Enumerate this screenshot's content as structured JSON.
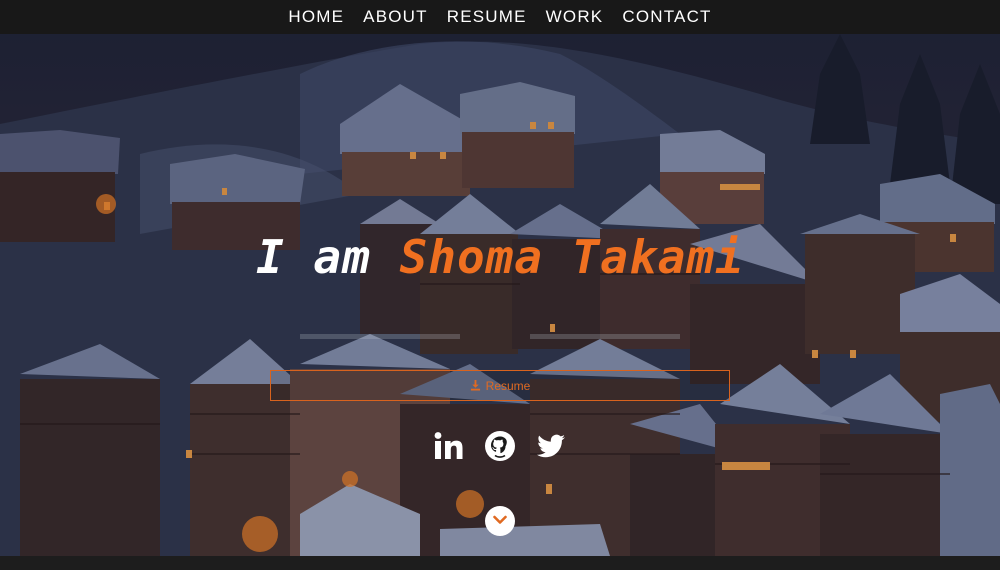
{
  "nav": {
    "items": [
      {
        "label": "HOME"
      },
      {
        "label": "ABOUT"
      },
      {
        "label": "RESUME"
      },
      {
        "label": "WORK"
      },
      {
        "label": "CONTACT"
      }
    ]
  },
  "hero": {
    "headline_prefix": "I am ",
    "headline_name": "Shoma Takami",
    "resume_button_label": "Resume",
    "resume_button_icon": "download-icon",
    "socials": [
      {
        "icon": "linkedin-icon"
      },
      {
        "icon": "github-icon"
      },
      {
        "icon": "twitter-icon"
      }
    ],
    "scroll_icon": "chevron-down-icon"
  },
  "colors": {
    "accent": "#f07020",
    "nav_bg": "#181818",
    "text": "#ffffff"
  }
}
